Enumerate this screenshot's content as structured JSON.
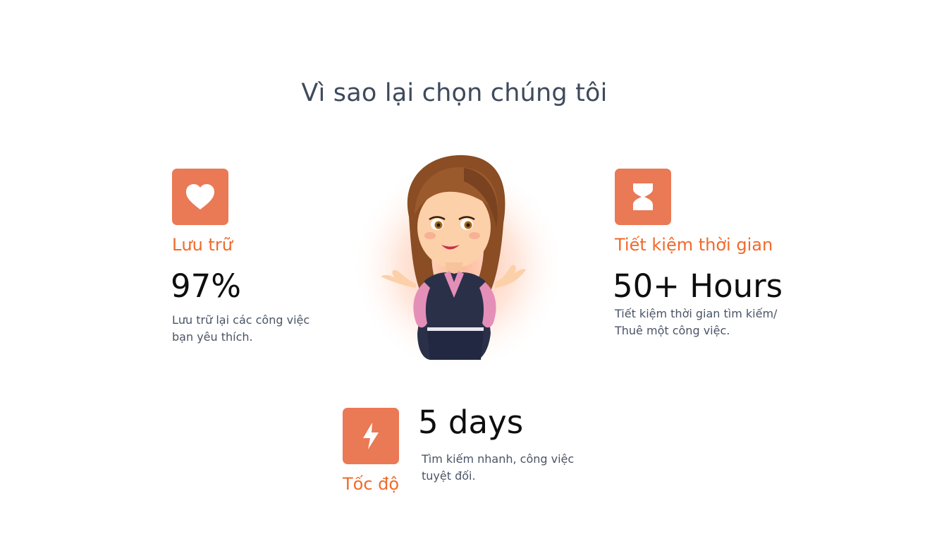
{
  "section": {
    "title": "Vì sao lại chọn chúng tôi"
  },
  "features": {
    "storage": {
      "icon": "heart-icon",
      "title": "Lưu trữ",
      "stat": "97%",
      "desc_line1": "Lưu trữ lại các công việc",
      "desc_line2": "bạn yêu thích."
    },
    "time": {
      "icon": "hourglass-icon",
      "title": "Tiết kiệm thời gian",
      "stat": "50+ Hours",
      "desc_line1": "Tiết kiệm thời gian tìm kiếm/",
      "desc_line2": "Thuê một công việc."
    },
    "speed": {
      "icon": "lightning-icon",
      "title": "Tốc độ",
      "stat": "5 days",
      "desc_line1": "Tìm kiếm nhanh, công việc",
      "desc_line2": "tuyệt đối."
    }
  },
  "illustration": {
    "subject": "woman-cartoon-illustration"
  },
  "colors": {
    "accent_icon_bg": "#ea7955",
    "accent_title": "#f06a2a",
    "heading": "#3e4a5c",
    "body_text": "#4a5466",
    "stat_text": "#0e0e0e",
    "background": "#ffffff"
  }
}
